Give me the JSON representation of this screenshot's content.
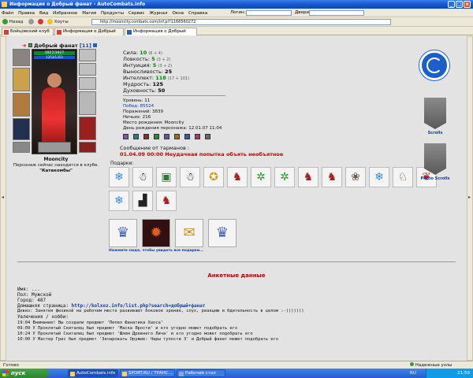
{
  "window": {
    "title": "Информация о Добрый фанат - AutoCombats.info",
    "min": "_",
    "max": "□",
    "close": "x"
  },
  "menu": [
    "Файл",
    "Правка",
    "Вид",
    "Избранное",
    "Магия",
    "Продукты",
    "Сервис",
    "Журнал",
    "Окна",
    "Справка"
  ],
  "menu_login_label": "Логин:",
  "menu_doors_label": "Двери",
  "toolbar": {
    "back_label": "Назад",
    "favorites_label": "Хоуты",
    "address": "http://mooncity.combats.com/inf.pl?1168560272"
  },
  "tabs": [
    {
      "label": "Бойцовский клуб"
    },
    {
      "label": "Информация о Добрый фанат"
    },
    {
      "label": "Информация о Добрый фанат"
    }
  ],
  "character": {
    "name": "Добрый фанат",
    "level": "[11]",
    "hp_bar": "3927/3927",
    "mana_bar": "1353/1353",
    "city": "Mooncity",
    "location_text": "Персонаж сейчас находится в клубе.",
    "location_place": "\"Катакомбы\""
  },
  "stats": [
    {
      "label": "Сила:",
      "value": "10",
      "extra": "(6 + 4)"
    },
    {
      "label": "Ловкость:",
      "value": "5",
      "extra": "(3 + 2)"
    },
    {
      "label": "Интуиция:",
      "value": "5",
      "extra": "(3 + 2)"
    },
    {
      "label": "Выносливость:",
      "value": "25",
      "extra": ""
    },
    {
      "label": "Интеллект:",
      "value": "118",
      "extra": "(17 + 101)"
    },
    {
      "label": "Мудрость:",
      "value": "125",
      "extra": ""
    },
    {
      "label": "Духовность:",
      "value": "50",
      "extra": ""
    }
  ],
  "info": [
    "Уровень: 11",
    "Побед: 85524",
    "Поражений: 3839",
    "Ничьих: 216",
    "Место рождения: Mooncity",
    "День рождения персонажа: 12.01.07 11:04"
  ],
  "tarmans": {
    "heading": "Сообщение от тарманов :",
    "date": "01.04.09 00:00",
    "text": "Неудачная попытка объять необъятное"
  },
  "gifts": {
    "heading": "Подарки:",
    "more_link": "Нажмите сюда, чтобы увидеть все подарки..."
  },
  "right": {
    "scrolls_label": "Scrolls",
    "photo_label": "Photo Scrolls"
  },
  "anketa": {
    "heading": "Анкетные данные",
    "name": "Имя: ...",
    "gender": "Пол: Мужской",
    "city": "Город: 487",
    "homepage_label": "Домашняя страница:",
    "homepage_url": "http://kolxoz.info/list.php?search=добрый+фанат",
    "motto": "Девиз: Занятия физикой на рабочем месте развивают боковое зрение, слух, реакцию и бдительность в целом :-)))))))",
    "hobby": "Увлечения / хобби:",
    "events": [
      "19:04 Внимание! Вы создали предмет 'Пепел Фанатика Хаоса'",
      "09:09 У Проклятый Скиталец был предмет 'Маска Ярости' и кто угодно может подобрать его",
      "10:24 У Проклятый Скиталец был предмет 'Шлем Древнего Лича' и кто угодно может подобрать его",
      "10:00 У Мастер Грис был предмет 'Зачаровать Оружие: Чары тупости 3' и Добрый фанат может подобрать его"
    ]
  },
  "status": {
    "left": "Готово",
    "right": "Надежные узлы"
  },
  "taskbar": {
    "start": "пуск",
    "items": [
      "AutoCombats.info",
      "SPORT.RU / ТРАНС...",
      "Рабочий стол"
    ],
    "lang": "RU",
    "clock": "21:59"
  },
  "colors": {
    "stat_value": "#008800",
    "tarmans_date": "#cc0000",
    "anketa_heading": "#b00000",
    "link": "#123c98",
    "title_bar": "#1454d0"
  }
}
